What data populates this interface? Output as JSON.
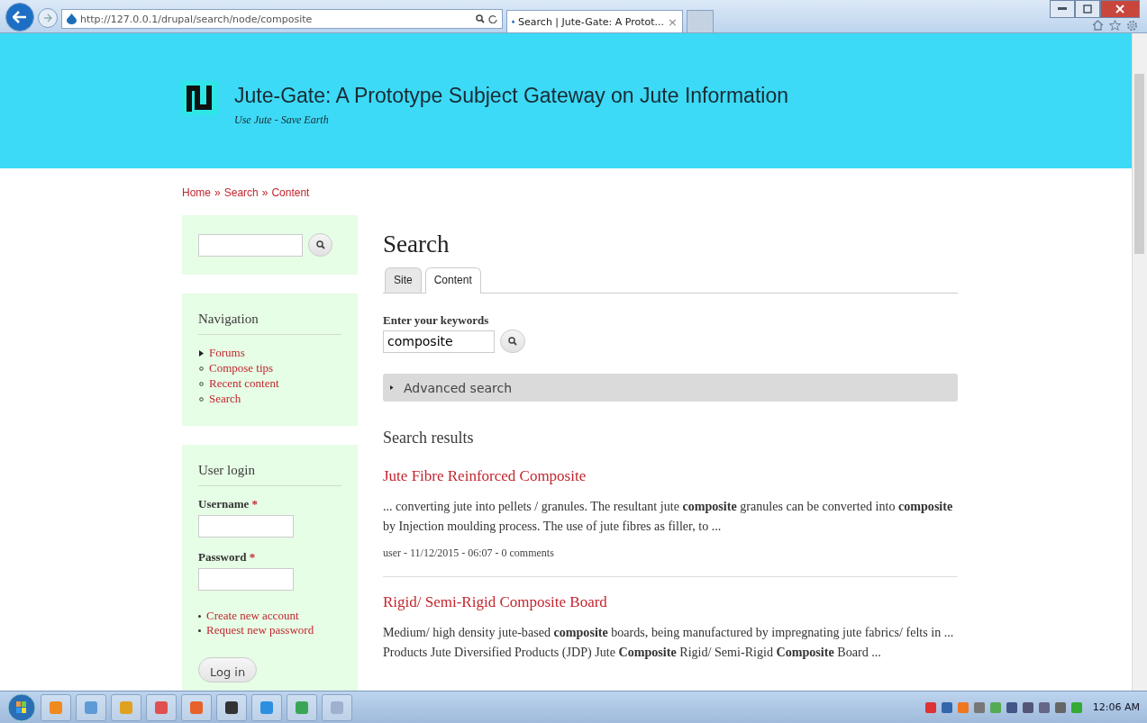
{
  "browser": {
    "address": "http://127.0.0.1/drupal/search/node/composite",
    "tab_title": "Search | Jute-Gate: A Protot...",
    "tab_close": "×"
  },
  "site": {
    "name": "Jute-Gate: A Prototype Subject Gateway on Jute Information",
    "slogan": "Use Jute - Save Earth"
  },
  "breadcrumb": [
    {
      "label": "Home"
    },
    {
      "label": "Search"
    },
    {
      "label": "Content"
    }
  ],
  "breadcrumb_separator": "»",
  "sidebar": {
    "navigation": {
      "title": "Navigation",
      "items": [
        {
          "label": "Forums",
          "kind": "collapsed"
        },
        {
          "label": "Compose tips",
          "kind": "leaf"
        },
        {
          "label": "Recent content",
          "kind": "leaf"
        },
        {
          "label": "Search",
          "kind": "leaf"
        }
      ]
    },
    "login": {
      "title": "User login",
      "fields": [
        {
          "label": "Username",
          "required_mark": "*"
        },
        {
          "label": "Password",
          "required_mark": "*"
        }
      ],
      "links": [
        {
          "label": "Create new account"
        },
        {
          "label": "Request new password"
        }
      ],
      "button": "Log in"
    }
  },
  "main": {
    "title": "Search",
    "tabs": [
      {
        "label": "Site",
        "selected": false
      },
      {
        "label": "Content",
        "selected": true
      }
    ],
    "keywords_label": "Enter your keywords",
    "keywords_value": "composite",
    "advanced": {
      "label": "Advanced search",
      "expanded": false
    },
    "results_title": "Search results",
    "results": [
      {
        "title": "Jute Fibre Reinforced Composite",
        "snippet": "... converting jute into pellets / granules. The resultant jute **composite** granules can be converted into **composite** by Injection moulding process. The use of jute fibres as filler, to ...",
        "meta": "user - 11/12/2015 - 06:07 - 0 comments"
      },
      {
        "title": "Rigid/ Semi-Rigid Composite Board",
        "snippet": "Medium/ high density jute-based **composite** boards, being manufactured by impregnating jute fabrics/ felts in ... Products Jute Diversified Products (JDP) Jute **Composite** Rigid/ Semi-Rigid **Composite** Board ..."
      }
    ]
  },
  "taskbar": {
    "apps": [
      {
        "color": "#f08a1c"
      },
      {
        "color": "#5d9bd6"
      },
      {
        "color": "#e0a020"
      },
      {
        "color": "#e05050"
      },
      {
        "color": "#e8602a"
      },
      {
        "color": "#333333"
      },
      {
        "color": "#2d8fe0"
      },
      {
        "color": "#3aa655"
      },
      {
        "color": "#a0b0d0"
      }
    ],
    "clock": "12:06 AM"
  }
}
